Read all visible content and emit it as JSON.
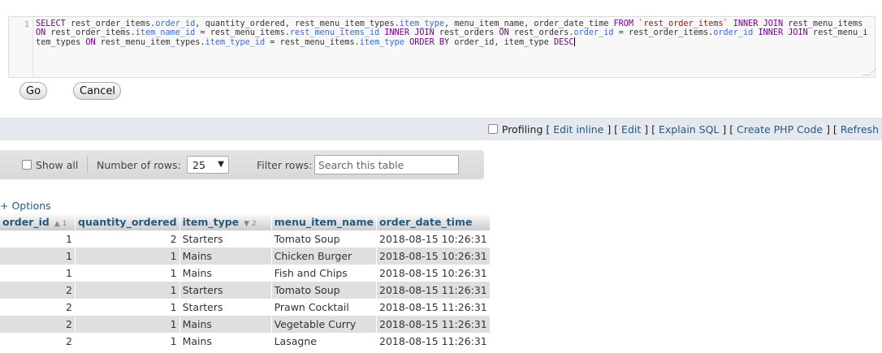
{
  "sql": {
    "line_number": "1",
    "tokens": [
      {
        "t": "SELECT",
        "c": "kw"
      },
      {
        "t": " rest_order_items.",
        "c": ""
      },
      {
        "t": "order_id",
        "c": "col"
      },
      {
        "t": ", quantity_ordered, rest_menu_item_types.",
        "c": ""
      },
      {
        "t": "item_type",
        "c": "col"
      },
      {
        "t": ", menu_item_name, order_date_time ",
        "c": ""
      },
      {
        "t": "FROM",
        "c": "kw"
      },
      {
        "t": " ",
        "c": ""
      },
      {
        "t": "`rest_order_items`",
        "c": "str"
      },
      {
        "t": " ",
        "c": ""
      },
      {
        "t": "INNER JOIN",
        "c": "kw"
      },
      {
        "t": " rest_menu_items ",
        "c": ""
      },
      {
        "t": "ON",
        "c": "kw"
      },
      {
        "t": " rest_order_items.",
        "c": ""
      },
      {
        "t": "item_name_id",
        "c": "col"
      },
      {
        "t": " = rest_menu_items.",
        "c": ""
      },
      {
        "t": "rest_menu_items_id",
        "c": "col"
      },
      {
        "t": " ",
        "c": ""
      },
      {
        "t": "INNER JOIN",
        "c": "kw"
      },
      {
        "t": " rest_orders ",
        "c": ""
      },
      {
        "t": "ON",
        "c": "kw"
      },
      {
        "t": " rest_orders.",
        "c": ""
      },
      {
        "t": "order_id",
        "c": "col"
      },
      {
        "t": " = rest_order_items.",
        "c": ""
      },
      {
        "t": "order_id",
        "c": "col"
      },
      {
        "t": " ",
        "c": ""
      },
      {
        "t": "INNER JOIN",
        "c": "kw"
      },
      {
        "t": " rest_menu_item_types ",
        "c": ""
      },
      {
        "t": "ON",
        "c": "kw"
      },
      {
        "t": " rest_menu_item_types.",
        "c": ""
      },
      {
        "t": "item_type_id",
        "c": "col"
      },
      {
        "t": " = rest_menu_items.",
        "c": ""
      },
      {
        "t": "item_type",
        "c": "col"
      },
      {
        "t": " ",
        "c": ""
      },
      {
        "t": "ORDER BY",
        "c": "kw"
      },
      {
        "t": " order_id, item_type ",
        "c": ""
      },
      {
        "t": "DESC",
        "c": "kw"
      }
    ]
  },
  "buttons": {
    "go": "Go",
    "cancel": "Cancel"
  },
  "linkbar": {
    "profiling": "Profiling",
    "links": [
      "Edit inline",
      "Edit",
      "Explain SQL",
      "Create PHP Code",
      "Refresh"
    ]
  },
  "nav": {
    "show_all": "Show all",
    "rows_label": "Number of rows:",
    "rows_value": "25",
    "filter_label": "Filter rows:",
    "search_placeholder": "Search this table"
  },
  "options_link": "+ Options",
  "table": {
    "columns": [
      {
        "label": "order_id",
        "sort": "▲ 1"
      },
      {
        "label": "quantity_ordered",
        "sort": ""
      },
      {
        "label": "item_type",
        "sort": "▼ 2"
      },
      {
        "label": "menu_item_name",
        "sort": ""
      },
      {
        "label": "order_date_time",
        "sort": ""
      }
    ],
    "rows": [
      [
        "1",
        "2",
        "Starters",
        "Tomato Soup",
        "2018-08-15 10:26:31"
      ],
      [
        "1",
        "1",
        "Mains",
        "Chicken Burger",
        "2018-08-15 10:26:31"
      ],
      [
        "1",
        "1",
        "Mains",
        "Fish and Chips",
        "2018-08-15 10:26:31"
      ],
      [
        "2",
        "1",
        "Starters",
        "Tomato Soup",
        "2018-08-15 11:26:31"
      ],
      [
        "2",
        "1",
        "Starters",
        "Prawn Cocktail",
        "2018-08-15 11:26:31"
      ],
      [
        "2",
        "1",
        "Mains",
        "Vegetable Curry",
        "2018-08-15 11:26:31"
      ],
      [
        "2",
        "1",
        "Mains",
        "Lasagne",
        "2018-08-15 11:26:31"
      ]
    ]
  }
}
